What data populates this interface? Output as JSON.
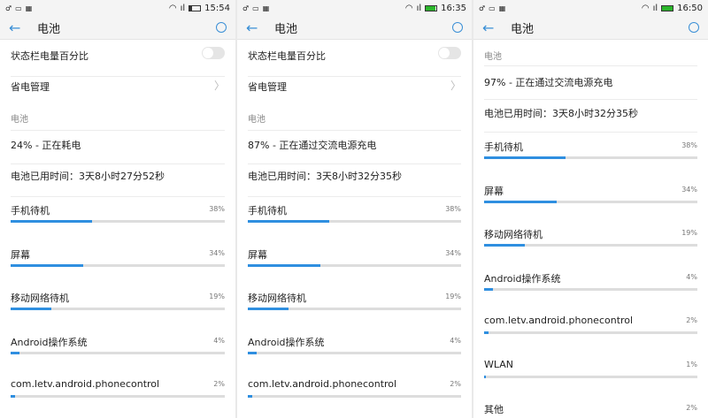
{
  "title": "电池",
  "toggle_label": "状态栏电量百分比",
  "power_mgmt_label": "省电管理",
  "section_label": "电池",
  "accent": "#2f8fe0",
  "panels": [
    {
      "time": "15:54",
      "charging": false,
      "battery_level": 24,
      "status": "24% - 正在耗电",
      "used_time": "电池已用时间：3天8小时27分52秒",
      "show_settings": true,
      "apps": [
        {
          "name": "手机待机",
          "pct": "38%",
          "v": 38
        },
        {
          "name": "屏幕",
          "pct": "34%",
          "v": 34
        },
        {
          "name": "移动网络待机",
          "pct": "19%",
          "v": 19
        },
        {
          "name": "Android操作系统",
          "pct": "4%",
          "v": 4
        },
        {
          "name": "com.letv.android.phonecontrol",
          "pct": "2%",
          "v": 2
        }
      ]
    },
    {
      "time": "16:35",
      "charging": true,
      "battery_level": 87,
      "status": "87% - 正在通过交流电源充电",
      "used_time": "电池已用时间：3天8小时32分35秒",
      "show_settings": true,
      "apps": [
        {
          "name": "手机待机",
          "pct": "38%",
          "v": 38
        },
        {
          "name": "屏幕",
          "pct": "34%",
          "v": 34
        },
        {
          "name": "移动网络待机",
          "pct": "19%",
          "v": 19
        },
        {
          "name": "Android操作系统",
          "pct": "4%",
          "v": 4
        },
        {
          "name": "com.letv.android.phonecontrol",
          "pct": "2%",
          "v": 2
        }
      ]
    },
    {
      "time": "16:50",
      "charging": true,
      "battery_level": 97,
      "status": "97% - 正在通过交流电源充电",
      "used_time": "电池已用时间：3天8小时32分35秒",
      "show_settings": false,
      "apps": [
        {
          "name": "手机待机",
          "pct": "38%",
          "v": 38
        },
        {
          "name": "屏幕",
          "pct": "34%",
          "v": 34
        },
        {
          "name": "移动网络待机",
          "pct": "19%",
          "v": 19
        },
        {
          "name": "Android操作系统",
          "pct": "4%",
          "v": 4
        },
        {
          "name": "com.letv.android.phonecontrol",
          "pct": "2%",
          "v": 2
        },
        {
          "name": "WLAN",
          "pct": "1%",
          "v": 1
        },
        {
          "name": "其他",
          "pct": "2%",
          "v": 2
        }
      ]
    }
  ]
}
